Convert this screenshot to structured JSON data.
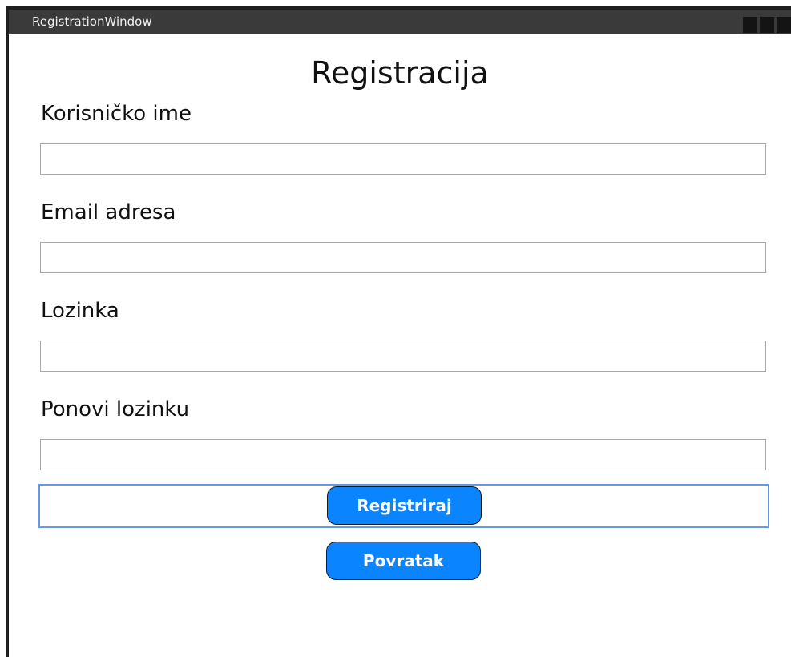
{
  "window": {
    "title": "RegistrationWindow"
  },
  "form": {
    "title": "Registracija",
    "fields": [
      {
        "label": "Korisničko ime",
        "value": ""
      },
      {
        "label": "Email adresa",
        "value": ""
      },
      {
        "label": "Lozinka",
        "value": ""
      },
      {
        "label": "Ponovi lozinku",
        "value": ""
      }
    ]
  },
  "buttons": {
    "register_label": "Registriraj",
    "back_label": "Povratak"
  },
  "colors": {
    "titlebar": "#3a3a3a",
    "button_fill": "#0b84ff",
    "focus_border": "#6a96e6"
  }
}
